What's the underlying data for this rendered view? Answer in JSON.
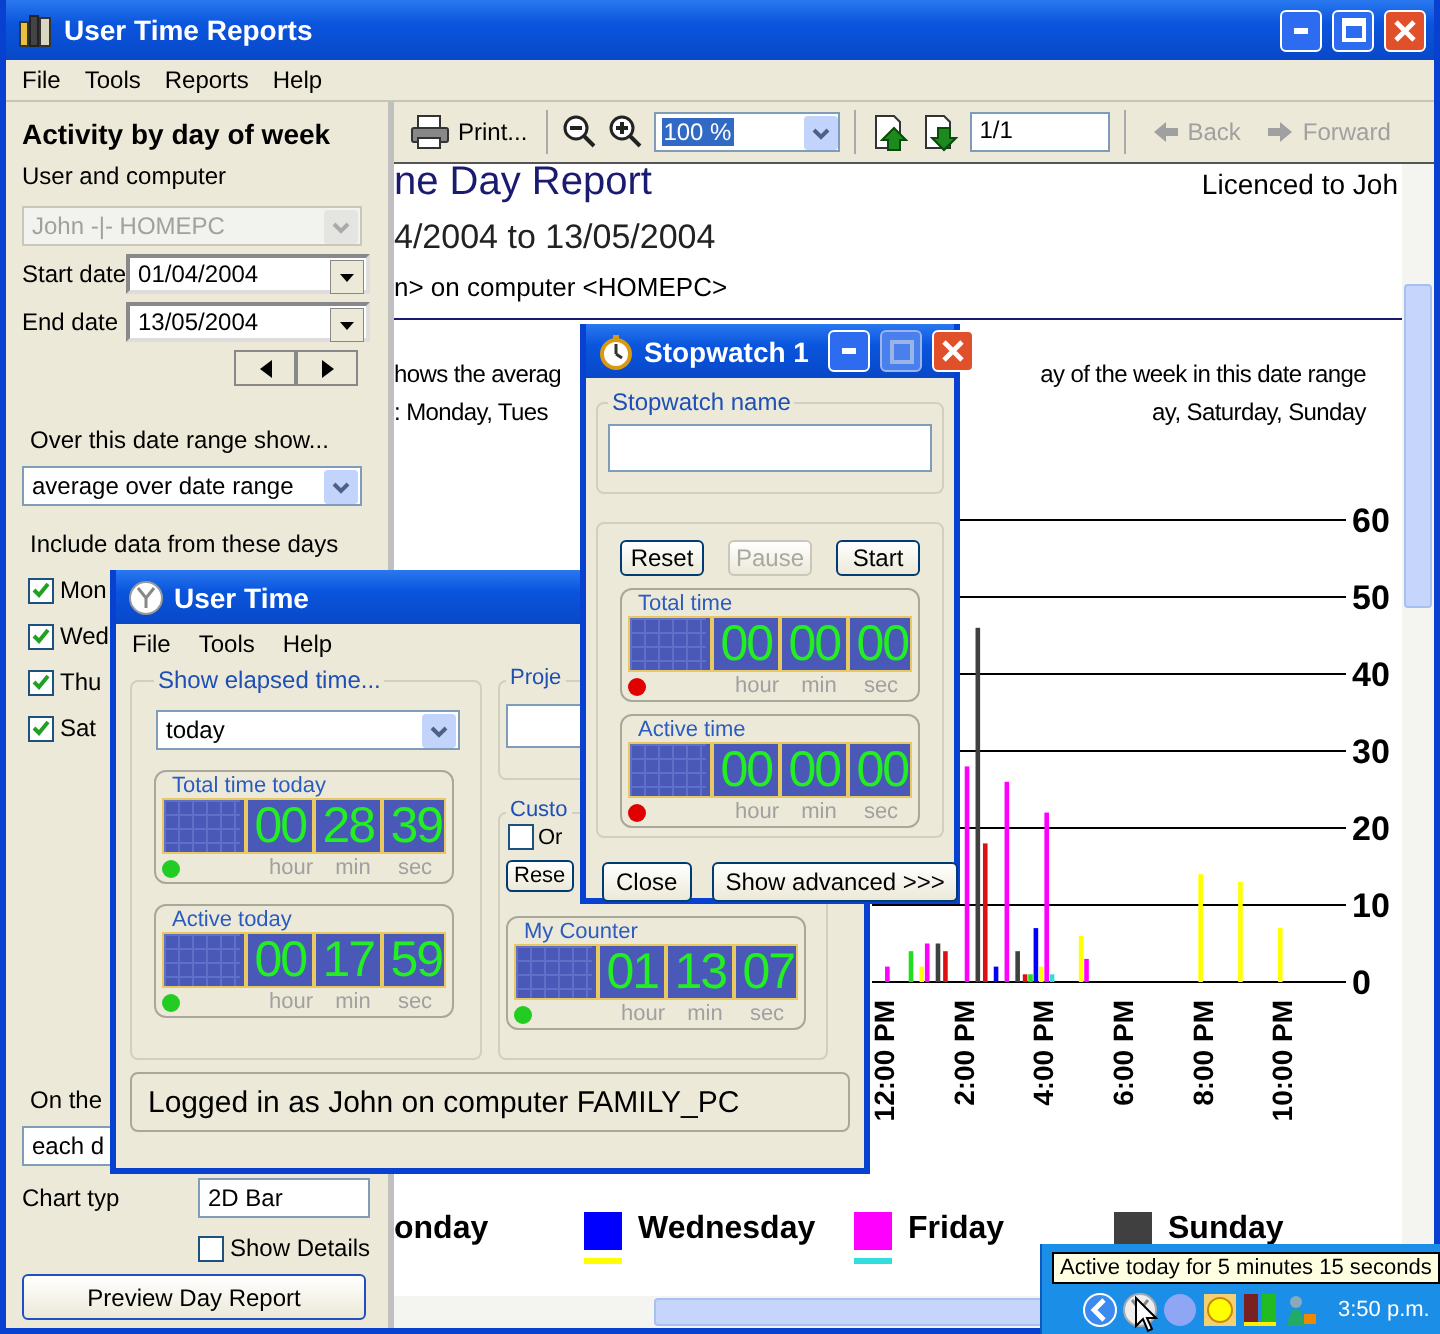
{
  "main_window": {
    "title": "User Time Reports",
    "menu": [
      "File",
      "Tools",
      "Reports",
      "Help"
    ]
  },
  "sidebar": {
    "heading": "Activity by day of week",
    "user_label": "User and computer",
    "user_value": "John -|- HOMEPC",
    "user_disabled": true,
    "start_label": "Start date",
    "start_value": "01/04/2004",
    "end_label": "End date",
    "end_value": "13/05/2004",
    "range_label": "Over this date range show...",
    "range_value": "average over date range",
    "days_label": "Include data from these days",
    "days": [
      {
        "label": "Mon",
        "checked": true
      },
      {
        "label": "Wed",
        "checked": true
      },
      {
        "label": "Thu",
        "checked": true
      },
      {
        "label": "Sat",
        "checked": true
      }
    ],
    "group_label": "On the",
    "group_value": "each d",
    "chart_type_label": "Chart typ",
    "chart_type_value": "2D Bar",
    "show_details": {
      "label": "Show Details",
      "checked": false
    },
    "preview_button": "Preview Day Report"
  },
  "toolbar": {
    "print": "Print...",
    "zoom": "100 %",
    "page": "1/1",
    "back": {
      "label": "Back",
      "disabled": true
    },
    "forward": {
      "label": "Forward",
      "disabled": true
    }
  },
  "report": {
    "title": "ne Day Report",
    "licence": "Licenced to Joh",
    "date_range": "4/2004 to 13/05/2004",
    "user_line": "n> on computer <HOMEPC>",
    "description": [
      {
        "left": "hows the averag",
        "right": "ay of the week in this date range"
      },
      {
        "left": ":  Monday, Tues",
        "right": "ay, Saturday, Sunday"
      }
    ],
    "chart_data": {
      "type": "bar",
      "x": [
        12,
        13,
        14,
        15,
        16,
        17,
        20,
        21,
        22
      ],
      "xlim": [
        11.75,
        23.65
      ],
      "ylim": [
        0,
        60
      ],
      "yticks": [
        0,
        10,
        20,
        30,
        40,
        50,
        60
      ],
      "grid": true,
      "xticks": [
        {
          "value": 12,
          "label": "12:00 PM"
        },
        {
          "value": 14,
          "label": "2:00 PM"
        },
        {
          "value": 16,
          "label": "4:00 PM"
        },
        {
          "value": 18,
          "label": "6:00 PM"
        },
        {
          "value": 20,
          "label": "8:00 PM"
        },
        {
          "value": 22,
          "label": "10:00 PM"
        }
      ],
      "series": [
        {
          "color": "#dd1111",
          "values": [
            null,
            null,
            4,
            18,
            1,
            null,
            null,
            null,
            null
          ]
        },
        {
          "color": "#22dd22",
          "values": [
            null,
            4,
            null,
            null,
            1,
            null,
            null,
            null,
            null
          ]
        },
        {
          "color": "#0000ff",
          "values": [
            null,
            null,
            null,
            2,
            7,
            null,
            null,
            null,
            null
          ]
        },
        {
          "color": "#ffff00",
          "values": [
            null,
            2,
            null,
            null,
            2,
            6,
            14,
            13,
            7
          ]
        },
        {
          "color": "#ff00ff",
          "values": [
            2,
            5,
            28,
            26,
            22,
            3,
            null,
            null,
            null
          ]
        },
        {
          "color": "#33dddd",
          "values": [
            null,
            null,
            null,
            null,
            1,
            null,
            null,
            null,
            null
          ]
        },
        {
          "color": "#404040",
          "values": [
            null,
            5,
            46,
            4,
            null,
            null,
            null,
            null,
            null
          ]
        }
      ]
    },
    "legend": [
      {
        "label": "onday"
      },
      {
        "label": "Wednesday",
        "color": "#0000ff"
      },
      {
        "label": "Friday",
        "color": "#ff00ff"
      },
      {
        "label": "Sunday",
        "color": "#404040"
      }
    ],
    "legend_row_2": [
      {
        "color": "#ffff00"
      },
      {
        "color": "#33dddd"
      }
    ]
  },
  "user_time_window": {
    "title": "User Time",
    "menu": [
      "File",
      "Tools",
      "Help"
    ],
    "elapsed_label": "Show elapsed time...",
    "elapsed_value": "today",
    "timers": [
      {
        "label": "Total time today",
        "digits": [
          "00",
          "28",
          "39"
        ],
        "units": [
          "hour",
          "min",
          "sec"
        ],
        "running": true
      },
      {
        "label": "Active today",
        "digits": [
          "00",
          "17",
          "59"
        ],
        "units": [
          "hour",
          "min",
          "sec"
        ],
        "running": true
      }
    ],
    "project_label": "Proje",
    "custom_label": "Custo",
    "custom_checkbox": {
      "label": "Or",
      "checked": false
    },
    "reset_button": "Rese",
    "counter": {
      "label": "My Counter",
      "digits": [
        "01",
        "13",
        "07"
      ],
      "units": [
        "hour",
        "min",
        "sec"
      ],
      "running": true
    },
    "status": "Logged in as John on computer FAMILY_PC"
  },
  "stopwatch_window": {
    "title": "Stopwatch 1",
    "name_label": "Stopwatch name",
    "buttons": [
      {
        "label": "Reset",
        "disabled": false
      },
      {
        "label": "Pause",
        "disabled": true
      },
      {
        "label": "Start",
        "disabled": false
      }
    ],
    "timers": [
      {
        "label": "Total time",
        "digits": [
          "00",
          "00",
          "00"
        ],
        "units": [
          "hour",
          "min",
          "sec"
        ],
        "running": false
      },
      {
        "label": "Active time",
        "digits": [
          "00",
          "00",
          "00"
        ],
        "units": [
          "hour",
          "min",
          "sec"
        ],
        "running": false
      }
    ],
    "close_button": "Close",
    "advanced_button": "Show advanced >>>"
  },
  "tray": {
    "tooltip": "Active today for 5 minutes 15 seconds",
    "clock": "3:50 p.m."
  }
}
